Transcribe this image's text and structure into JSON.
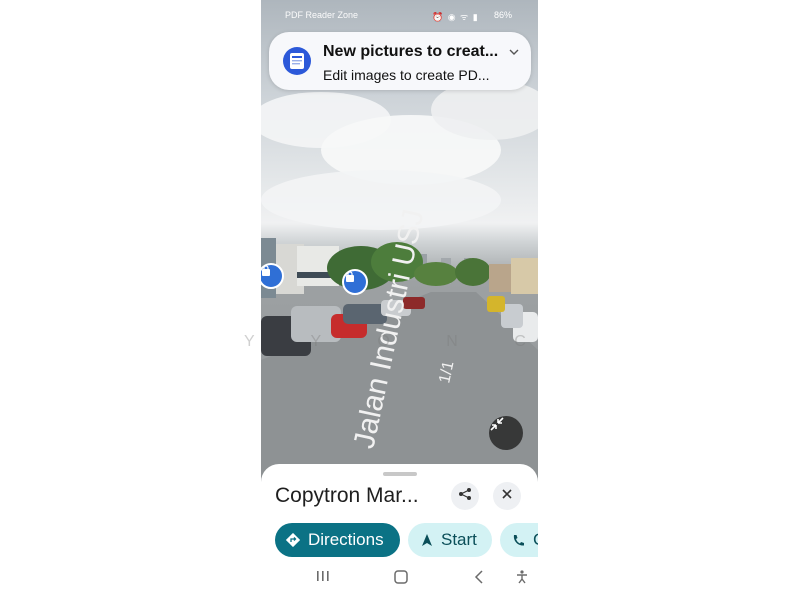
{
  "status_bar": {
    "app_label": "PDF Reader Zone",
    "icons": "⏰ ◉ ᯤ ▮",
    "battery": "86%"
  },
  "notification": {
    "title": "New pictures to creat...",
    "body": "Edit images to create PD...",
    "icon": "pdf-document-icon",
    "accent": "#2c59d9"
  },
  "street_view": {
    "road_text": "Jalan Industri USJ 1/1",
    "road_text_main": "Jalan Industri USJ",
    "road_text_number": "1/1",
    "watermark": "Y  Y O N C"
  },
  "place": {
    "title": "Copytron Mar...",
    "share_icon": "share-icon",
    "close_icon": "close-icon"
  },
  "actions": [
    {
      "label": "Directions",
      "icon": "directions-icon"
    },
    {
      "label": "Start",
      "icon": "navigation-arrow-icon"
    },
    {
      "label": "C",
      "icon": "phone-icon"
    }
  ],
  "colors": {
    "primary_chip": "#0b7285",
    "secondary_chip": "#d3f2f4",
    "pin": "#2f6fd6"
  },
  "nav": [
    "recent-apps-icon",
    "home-icon",
    "back-icon",
    "accessibility-icon"
  ]
}
